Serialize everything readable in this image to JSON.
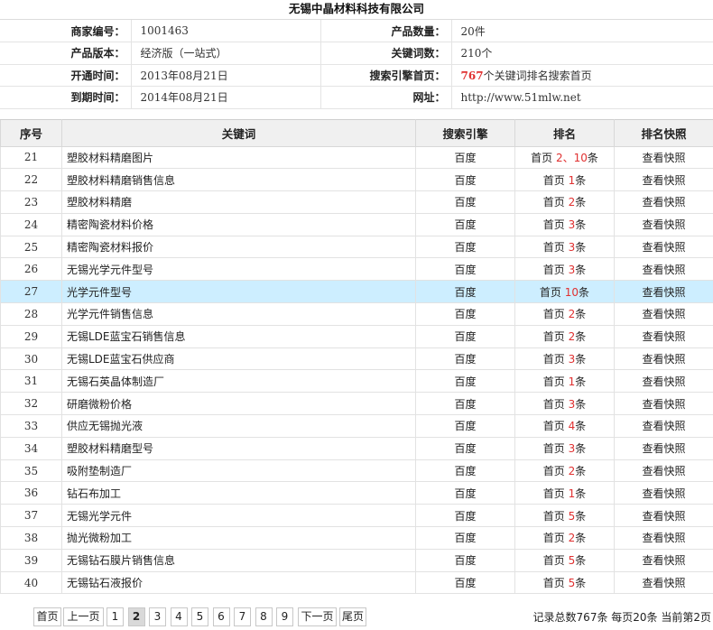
{
  "title": "无锡中晶材料科技有限公司",
  "info": {
    "merchant_id_label": "商家编号：",
    "merchant_id": "1001463",
    "product_count_label": "产品数量：",
    "product_count": "20件",
    "version_label": "产品版本：",
    "version": "经济版（一站式）",
    "keyword_count_label": "关键词数：",
    "keyword_count": "210个",
    "open_label": "开通时间：",
    "open_date": "2013年08月21日",
    "search_label": "搜索引擎首页：",
    "search_count": "767",
    "search_text": "个关键词排名搜索首页",
    "expire_label": "到期时间：",
    "expire_date": "2014年08月21日",
    "url_label": "网址：",
    "url": "http://www.51mlw.net"
  },
  "table": {
    "headers": [
      "序号",
      "关键词",
      "搜索引擎",
      "排名",
      "排名快照"
    ],
    "rows": [
      {
        "no": "21",
        "kw": "塑胶材料精磨图片",
        "eng": "百度",
        "pre": "首页",
        "n": "2、10",
        "suf": "条",
        "snap": "查看快照"
      },
      {
        "no": "22",
        "kw": "塑胶材料精磨销售信息",
        "eng": "百度",
        "pre": "首页",
        "n": "1",
        "suf": "条",
        "snap": "查看快照"
      },
      {
        "no": "23",
        "kw": "塑胶材料精磨",
        "eng": "百度",
        "pre": "首页",
        "n": "2",
        "suf": "条",
        "snap": "查看快照"
      },
      {
        "no": "24",
        "kw": "精密陶瓷材料价格",
        "eng": "百度",
        "pre": "首页",
        "n": "3",
        "suf": "条",
        "snap": "查看快照"
      },
      {
        "no": "25",
        "kw": "精密陶瓷材料报价",
        "eng": "百度",
        "pre": "首页",
        "n": "3",
        "suf": "条",
        "snap": "查看快照"
      },
      {
        "no": "26",
        "kw": "无锡光学元件型号",
        "eng": "百度",
        "pre": "首页",
        "n": "3",
        "suf": "条",
        "snap": "查看快照"
      },
      {
        "no": "27",
        "kw": "光学元件型号",
        "eng": "百度",
        "pre": "首页",
        "n": "10",
        "suf": "条",
        "snap": "查看快照"
      },
      {
        "no": "28",
        "kw": "光学元件销售信息",
        "eng": "百度",
        "pre": "首页",
        "n": "2",
        "suf": "条",
        "snap": "查看快照"
      },
      {
        "no": "29",
        "kw": "无锡LDE蓝宝石销售信息",
        "eng": "百度",
        "pre": "首页",
        "n": "2",
        "suf": "条",
        "snap": "查看快照"
      },
      {
        "no": "30",
        "kw": "无锡LDE蓝宝石供应商",
        "eng": "百度",
        "pre": "首页",
        "n": "3",
        "suf": "条",
        "snap": "查看快照"
      },
      {
        "no": "31",
        "kw": "无锡石英晶体制造厂",
        "eng": "百度",
        "pre": "首页",
        "n": "1",
        "suf": "条",
        "snap": "查看快照"
      },
      {
        "no": "32",
        "kw": "研磨微粉价格",
        "eng": "百度",
        "pre": "首页",
        "n": "3",
        "suf": "条",
        "snap": "查看快照"
      },
      {
        "no": "33",
        "kw": "供应无锡抛光液",
        "eng": "百度",
        "pre": "首页",
        "n": "4",
        "suf": "条",
        "snap": "查看快照"
      },
      {
        "no": "34",
        "kw": "塑胶材料精磨型号",
        "eng": "百度",
        "pre": "首页",
        "n": "3",
        "suf": "条",
        "snap": "查看快照"
      },
      {
        "no": "35",
        "kw": "吸附垫制造厂",
        "eng": "百度",
        "pre": "首页",
        "n": "2",
        "suf": "条",
        "snap": "查看快照"
      },
      {
        "no": "36",
        "kw": "钻石布加工",
        "eng": "百度",
        "pre": "首页",
        "n": "1",
        "suf": "条",
        "snap": "查看快照"
      },
      {
        "no": "37",
        "kw": "无锡光学元件",
        "eng": "百度",
        "pre": "首页",
        "n": "5",
        "suf": "条",
        "snap": "查看快照"
      },
      {
        "no": "38",
        "kw": "抛光微粉加工",
        "eng": "百度",
        "pre": "首页",
        "n": "2",
        "suf": "条",
        "snap": "查看快照"
      },
      {
        "no": "39",
        "kw": "无锡钻石膜片销售信息",
        "eng": "百度",
        "pre": "首页",
        "n": "5",
        "suf": "条",
        "snap": "查看快照"
      },
      {
        "no": "40",
        "kw": "无锡钻石液报价",
        "eng": "百度",
        "pre": "首页",
        "n": "5",
        "suf": "条",
        "snap": "查看快照"
      }
    ]
  },
  "pager": {
    "first": "首页",
    "prev": "上一页",
    "next": "下一页",
    "last": "尾页",
    "pages": [
      "1",
      "2",
      "3",
      "4",
      "5",
      "6",
      "7",
      "8",
      "9"
    ],
    "current": "2",
    "stats": "记录总数767条 每页20条 当前第2页"
  },
  "colors": {
    "highlight_row": "#cdeeff",
    "rank_number": "#e03030",
    "header_bg": "#f0f0f0"
  }
}
